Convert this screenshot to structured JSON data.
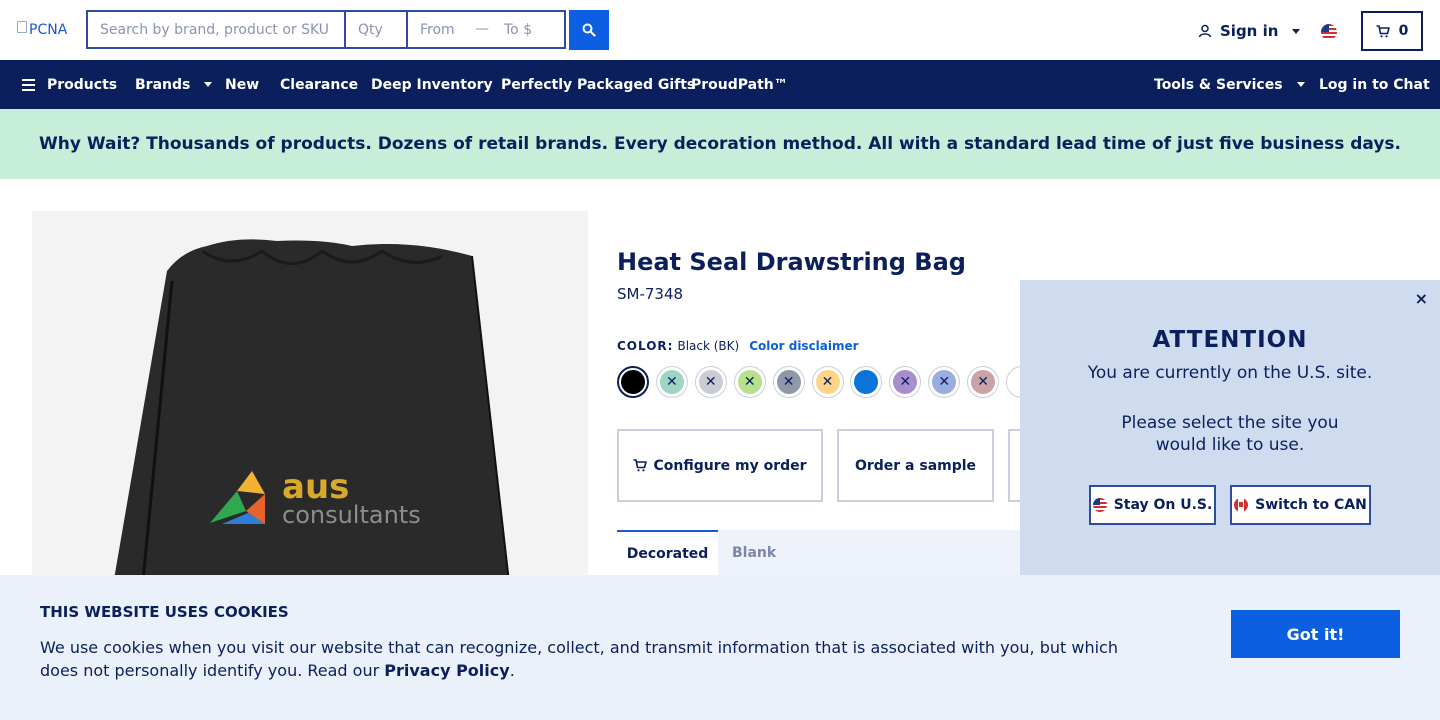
{
  "header": {
    "logo_alt": "PCNA",
    "search": {
      "placeholder": "Search by brand, product or SKU",
      "value": ""
    },
    "qty": {
      "placeholder": "Qty",
      "value": ""
    },
    "price_from": {
      "placeholder": "From $",
      "value": ""
    },
    "price_sep": "—",
    "price_to": {
      "placeholder": "To $",
      "value": ""
    },
    "signin_label": "Sign in",
    "cart_count": "0",
    "accent": "#0b5fe0"
  },
  "nav": {
    "items": [
      "Products",
      "Brands",
      "New",
      "Clearance",
      "Deep Inventory",
      "Perfectly Packaged Gifts",
      "ProudPath™"
    ],
    "tools_label": "Tools & Services",
    "chat_label": "Log in to Chat",
    "background": "#0b1f5c"
  },
  "banner": {
    "text": "Why Wait? Thousands of products. Dozens of retail brands. Every decoration method. All with a standard lead time of just five business days.",
    "background": "#c7eed8"
  },
  "product": {
    "image_brand_line1": "aus",
    "image_brand_line2": "consultants",
    "title": "Heat Seal Drawstring Bag",
    "sku": "SM-7348",
    "color_label": "COLOR:",
    "color_value": "Black (BK)",
    "color_disclaimer": "Color disclaimer",
    "swatches": [
      {
        "color": "#000000",
        "selected": true,
        "unavailable": false
      },
      {
        "color": "#9fd4c2",
        "selected": false,
        "unavailable": true
      },
      {
        "color": "#c9ccd4",
        "selected": false,
        "unavailable": true
      },
      {
        "color": "#b6e08a",
        "selected": false,
        "unavailable": true
      },
      {
        "color": "#8f97a8",
        "selected": false,
        "unavailable": true
      },
      {
        "color": "#ffd486",
        "selected": false,
        "unavailable": true
      },
      {
        "color": "#0b74d9",
        "selected": false,
        "unavailable": false
      },
      {
        "color": "#a68fcc",
        "selected": false,
        "unavailable": true
      },
      {
        "color": "#98aede",
        "selected": false,
        "unavailable": true
      },
      {
        "color": "#c9a3a8",
        "selected": false,
        "unavailable": true
      },
      {
        "color": "#ffffff",
        "selected": false,
        "unavailable": false
      }
    ],
    "actions": {
      "configure": "Configure my order",
      "sample": "Order a sample"
    },
    "tabs": [
      "Decorated",
      "Blank"
    ]
  },
  "modal": {
    "close_icon": "×",
    "title": "ATTENTION",
    "line1": "You are currently on the U.S. site.",
    "line2": "Please select the site you would like to use.",
    "stay_label": "Stay On U.S.",
    "switch_label": "Switch to CAN"
  },
  "cookie": {
    "title": "THIS WEBSITE USES COOKIES",
    "text_before": "We use cookies when you visit our website that can recognize, collect, and transmit information that is associated with you, but which does not personally identify you. Read our ",
    "link": "Privacy Policy",
    "text_after": ".",
    "button": "Got it!"
  }
}
